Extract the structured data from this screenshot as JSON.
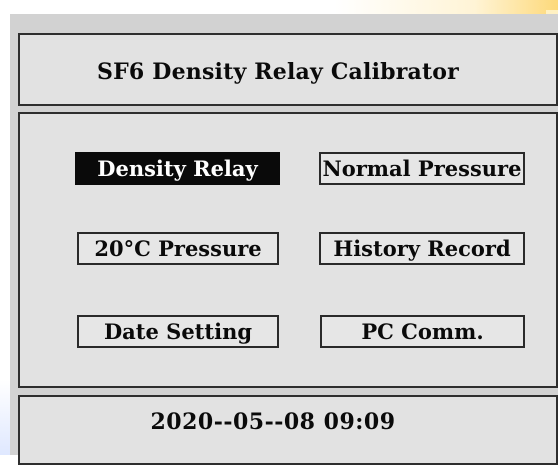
{
  "title": "SF6 Density Relay Calibrator",
  "menu": [
    {
      "label": "Density Relay",
      "selected": true
    },
    {
      "label": "Normal Pressure",
      "selected": false
    },
    {
      "label": "20°C Pressure",
      "selected": false
    },
    {
      "label": "History Record",
      "selected": false
    },
    {
      "label": "Date Setting",
      "selected": false
    },
    {
      "label": "PC  Comm.",
      "selected": false
    }
  ],
  "status": {
    "datetime": "2020--05--08  09:09"
  },
  "colors": {
    "panel_bg": "#e2e2e2",
    "selected_bg": "#0a0a0a",
    "selected_text": "#ffffff",
    "border": "#2e2e2e"
  }
}
